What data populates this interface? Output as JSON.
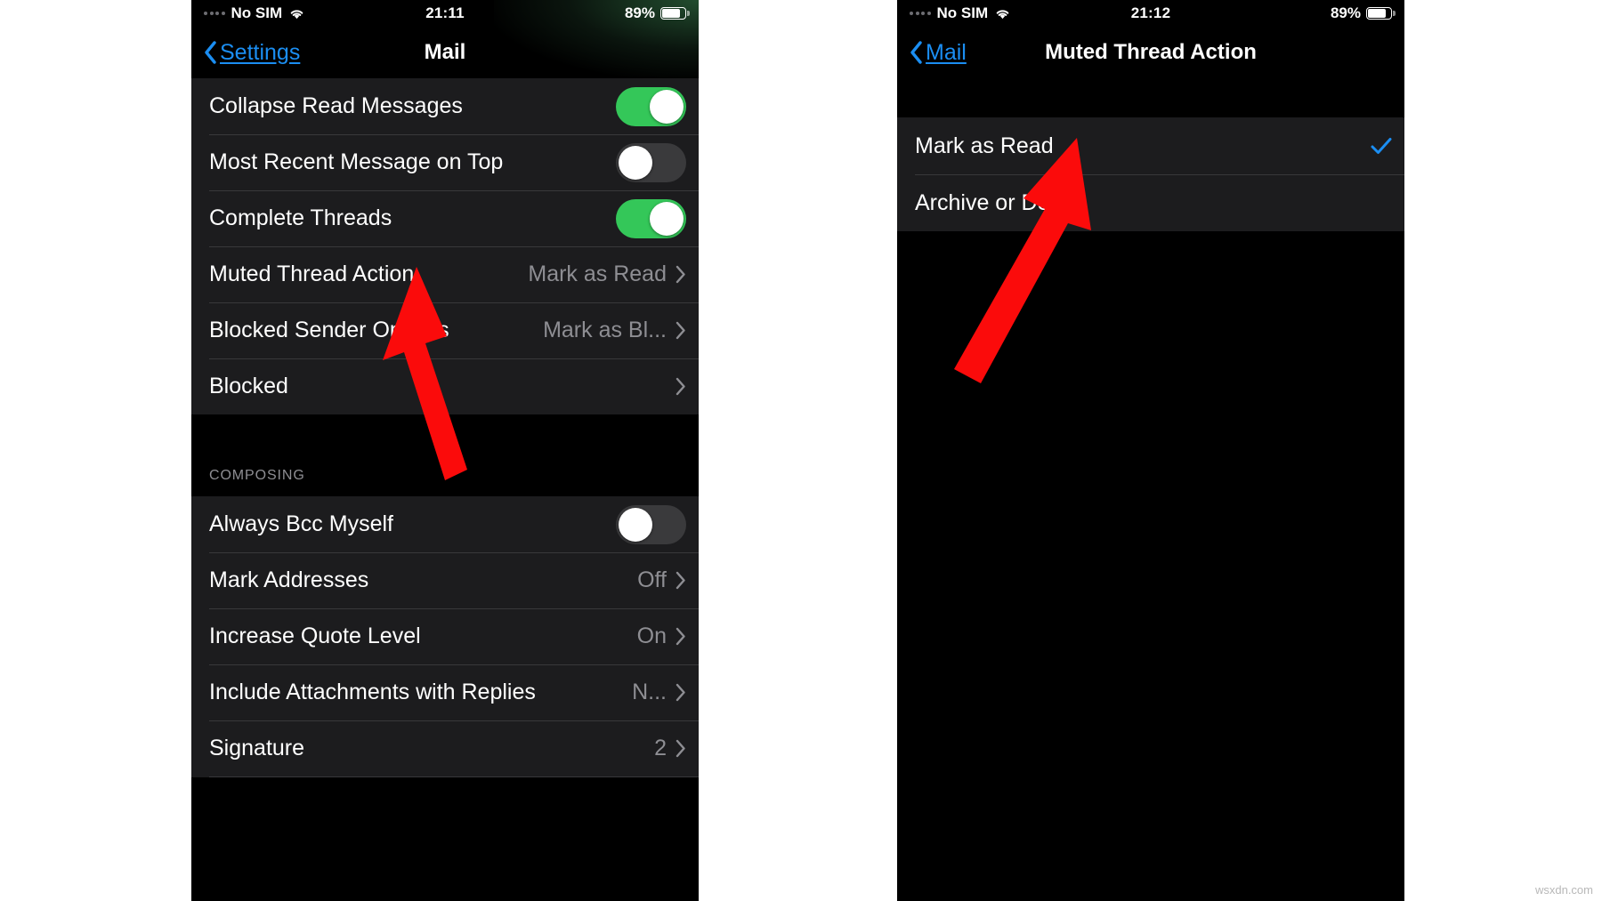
{
  "meta": {
    "watermark": "wsxdn.com",
    "colors": {
      "accent_blue": "#1b8ef2",
      "toggle_on_green": "#34c759",
      "row_background": "#1c1c1e",
      "separator": "#38383a",
      "secondary_text": "#8e8e93",
      "arrow_red": "#fb0b0b",
      "page_background": "#000000"
    }
  },
  "left_phone": {
    "status_bar": {
      "signal_icon": "signal-dots-icon",
      "carrier": "No SIM",
      "wifi_icon": "wifi-icon",
      "time": "21:11",
      "battery_percent": "89%",
      "battery_icon": "battery-icon"
    },
    "nav": {
      "back_icon": "chevron-left-icon",
      "back_label": "Settings",
      "title": "Mail"
    },
    "groups": [
      {
        "header": "",
        "rows": [
          {
            "label": "Collapse Read Messages",
            "type": "toggle",
            "value": "on",
            "name": "row-collapse-read-messages"
          },
          {
            "label": "Most Recent Message on Top",
            "type": "toggle",
            "value": "off",
            "name": "row-most-recent-message-on-top"
          },
          {
            "label": "Complete Threads",
            "type": "toggle",
            "value": "on",
            "name": "row-complete-threads"
          },
          {
            "label": "Muted Thread Action",
            "type": "disclosure",
            "value": "Mark as Read",
            "name": "row-muted-thread-action"
          },
          {
            "label": "Blocked Sender Options",
            "type": "disclosure",
            "value": "Mark as Bl...",
            "name": "row-blocked-sender-options"
          },
          {
            "label": "Blocked",
            "type": "disclosure",
            "value": "",
            "name": "row-blocked"
          }
        ]
      },
      {
        "header": "COMPOSING",
        "rows": [
          {
            "label": "Always Bcc Myself",
            "type": "toggle",
            "value": "off",
            "name": "row-always-bcc-myself"
          },
          {
            "label": "Mark Addresses",
            "type": "disclosure",
            "value": "Off",
            "name": "row-mark-addresses"
          },
          {
            "label": "Increase Quote Level",
            "type": "disclosure",
            "value": "On",
            "name": "row-increase-quote-level"
          },
          {
            "label": "Include Attachments with Replies",
            "type": "disclosure",
            "value": "N...",
            "name": "row-include-attachments-with-replies"
          },
          {
            "label": "Signature",
            "type": "disclosure",
            "value": "2",
            "name": "row-signature"
          }
        ]
      }
    ],
    "annotation": {
      "arrow_icon": "red-arrow-icon",
      "points_at": "Muted Thread Action"
    }
  },
  "right_phone": {
    "status_bar": {
      "signal_icon": "signal-dots-icon",
      "carrier": "No SIM",
      "wifi_icon": "wifi-icon",
      "time": "21:12",
      "battery_percent": "89%",
      "battery_icon": "battery-icon"
    },
    "nav": {
      "back_icon": "chevron-left-icon",
      "back_label": "Mail",
      "title": "Muted Thread Action"
    },
    "options": [
      {
        "label": "Mark as Read",
        "selected": true,
        "name": "option-mark-as-read"
      },
      {
        "label": "Archive or Delete",
        "selected": false,
        "name": "option-archive-or-delete"
      }
    ],
    "annotation": {
      "arrow_icon": "red-arrow-icon",
      "points_at": "Mark as Read"
    }
  }
}
